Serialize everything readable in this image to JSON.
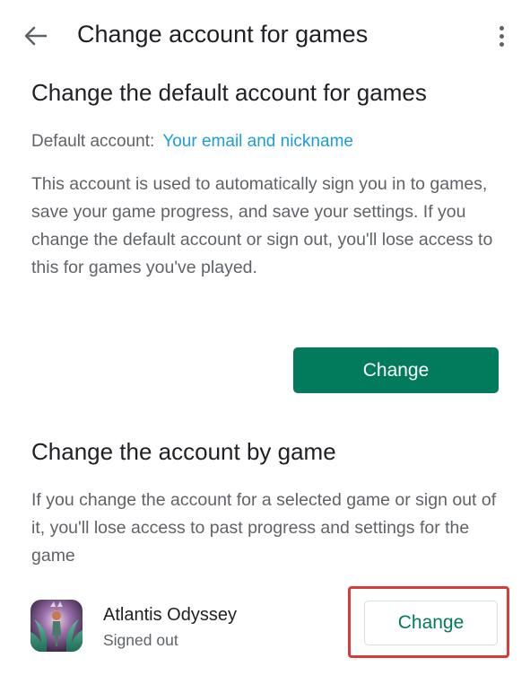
{
  "appbar": {
    "title": "Change account for games",
    "back_icon": "arrow-left-icon",
    "overflow_icon": "more-vert-icon"
  },
  "default_section": {
    "title": "Change the default account for games",
    "label": "Default account:",
    "value": "Your email and nickname",
    "description": "This account is used to automatically sign you in to games, save your game progress, and save your settings. If you change the default account or sign out, you'll lose access to this for games you've played.",
    "button_label": "Change"
  },
  "by_game_section": {
    "title": "Change the account by game",
    "description": "If you change the account for a selected game or sign out of it, you'll lose access to past progress and settings for the game",
    "games": [
      {
        "name": "Atlantis Odyssey",
        "status": "Signed out",
        "button_label": "Change"
      }
    ]
  },
  "colors": {
    "accent_green": "#017b5b",
    "link_blue": "#1a9fd4",
    "highlight_red": "#d93b3b",
    "text_primary": "#202124",
    "text_secondary": "#5f6368"
  }
}
